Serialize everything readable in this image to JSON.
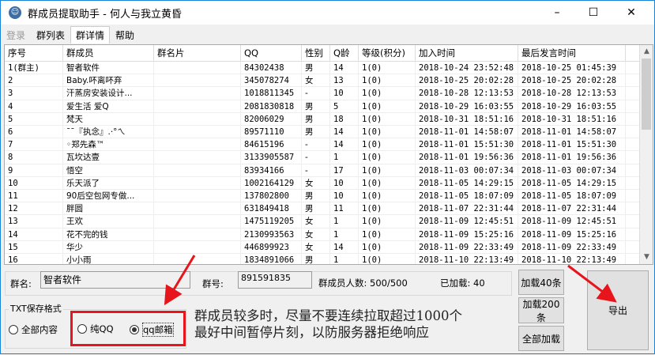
{
  "window": {
    "title": "群成员提取助手 - 何人与我立黄昏",
    "minimize": "–",
    "maximize": "☐",
    "close": "✕"
  },
  "tabs": [
    {
      "label": "登录"
    },
    {
      "label": "群列表"
    },
    {
      "label": "群详情"
    },
    {
      "label": "帮助"
    }
  ],
  "table": {
    "headers": [
      "序号",
      "群成员",
      "群名片",
      "QQ",
      "性别",
      "Q龄",
      "等级(积分)",
      "加入时间",
      "最后发言时间"
    ],
    "rows": [
      [
        "1(群主)",
        "智者软件",
        "",
        "84302438",
        "男",
        "14",
        "1(0)",
        "2018-10-24 23:52:48",
        "2018-10-25 01:45:39"
      ],
      [
        "2",
        "Baby.吥离吥弃",
        "",
        "345078274",
        "女",
        "13",
        "1(0)",
        "2018-10-25 20:02:28",
        "2018-10-25 20:02:28"
      ],
      [
        "3",
        "汗蒸房安装设计...",
        "",
        "1018811345",
        "-",
        "10",
        "1(0)",
        "2018-10-28 12:13:53",
        "2018-10-28 12:13:53"
      ],
      [
        "4",
        "爱生活 爱Q",
        "",
        "2081830818",
        "男",
        "5",
        "1(0)",
        "2018-10-29 16:03:55",
        "2018-10-29 16:03:55"
      ],
      [
        "5",
        "梵天",
        "",
        "82006029",
        "男",
        "18",
        "1(0)",
        "2018-10-31 18:51:16",
        "2018-10-31 18:51:16"
      ],
      [
        "6",
        "¯¯『执念』.·°ㄟ",
        "",
        "89571110",
        "男",
        "14",
        "1(0)",
        "2018-11-01 14:58:07",
        "2018-11-01 14:58:07"
      ],
      [
        "7",
        "◦郑先森™",
        "",
        "84615196",
        "-",
        "14",
        "1(0)",
        "2018-11-01 15:51:30",
        "2018-11-01 15:51:30"
      ],
      [
        "8",
        "瓦坎达壹",
        "",
        "3133905587",
        "-",
        "1",
        "1(0)",
        "2018-11-01 19:56:36",
        "2018-11-01 19:56:36"
      ],
      [
        "9",
        "悟空",
        "",
        "83934166",
        "-",
        "17",
        "1(0)",
        "2018-11-03 00:07:34",
        "2018-11-03 00:07:34"
      ],
      [
        "10",
        "乐天派了",
        "",
        "1002164129",
        "女",
        "10",
        "1(0)",
        "2018-11-05 14:29:15",
        "2018-11-05 14:29:15"
      ],
      [
        "11",
        "90后空包网专做...",
        "",
        "137802800",
        "男",
        "10",
        "1(0)",
        "2018-11-05 18:07:09",
        "2018-11-05 18:07:09"
      ],
      [
        "12",
        "胖圆",
        "",
        "631849418",
        "男",
        "11",
        "1(0)",
        "2018-11-07 22:31:44",
        "2018-11-07 22:31:44"
      ],
      [
        "13",
        "王欢",
        "",
        "1475119205",
        "女",
        "1",
        "1(0)",
        "2018-11-09 12:45:51",
        "2018-11-09 12:45:51"
      ],
      [
        "14",
        "花不完的钱",
        "",
        "2130993563",
        "女",
        "1",
        "1(0)",
        "2018-11-09 15:25:16",
        "2018-11-09 15:25:16"
      ],
      [
        "15",
        "华少",
        "",
        "446899923",
        "女",
        "14",
        "1(0)",
        "2018-11-09 22:33:49",
        "2018-11-09 22:33:49"
      ],
      [
        "16",
        "小小雨",
        "",
        "1834891066",
        "男",
        "1",
        "1(0)",
        "2018-11-10 22:13:49",
        "2018-11-10 22:13:49"
      ]
    ]
  },
  "info": {
    "group_name_label": "群名:",
    "group_name": "智者软件",
    "group_id_label": "群号:",
    "group_id": "891591835",
    "member_count": "群成员人数: 500/500",
    "loaded": "已加载: 40"
  },
  "buttons": {
    "load40": "加载40条",
    "load200": "加载200条",
    "load_all": "全部加载",
    "export": "导出"
  },
  "txt_format": {
    "title": "TXT保存格式",
    "options": [
      {
        "label": "全部内容",
        "selected": false
      },
      {
        "label": "纯QQ",
        "selected": false
      },
      {
        "label": "qq邮箱",
        "selected": true
      }
    ]
  },
  "notice": [
    "群成员较多时，尽量不要连续拉取超过1000个",
    "最好中间暂停片刻，以防服务器拒绝响应"
  ],
  "colors": {
    "annotation": "#e8141b",
    "accent": "#1883d7"
  }
}
